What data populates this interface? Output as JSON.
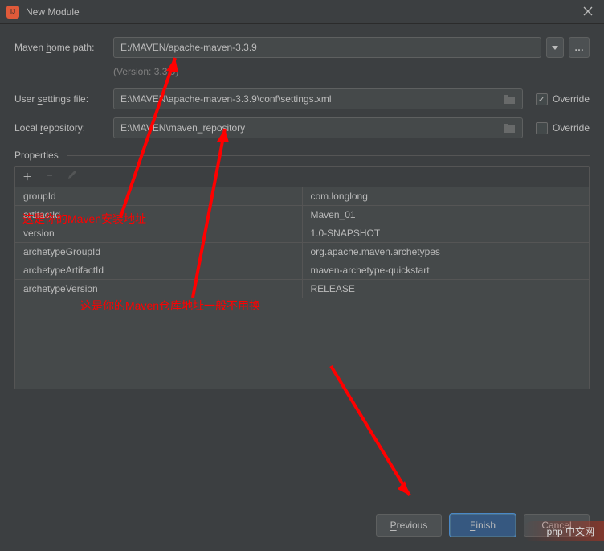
{
  "titlebar": {
    "title": "New Module"
  },
  "form": {
    "maven_home_label": "Maven home path:",
    "maven_home_value": "E:/MAVEN/apache-maven-3.3.9",
    "version_text": "(Version: 3.3.9)",
    "settings_label": "User settings file:",
    "settings_value": "E:\\MAVEN\\apache-maven-3.3.9\\conf\\settings.xml",
    "settings_override_checked": true,
    "repo_label": "Local repository:",
    "repo_value": "E:\\MAVEN\\maven_repository",
    "repo_override_checked": false,
    "override_label": "Override"
  },
  "properties": {
    "header": "Properties",
    "rows": [
      {
        "key": "groupId",
        "value": "com.longlong"
      },
      {
        "key": "artifactId",
        "value": "Maven_01"
      },
      {
        "key": "version",
        "value": "1.0-SNAPSHOT"
      },
      {
        "key": "archetypeGroupId",
        "value": "org.apache.maven.archetypes"
      },
      {
        "key": "archetypeArtifactId",
        "value": "maven-archetype-quickstart"
      },
      {
        "key": "archetypeVersion",
        "value": "RELEASE"
      }
    ]
  },
  "buttons": {
    "previous": "Previous",
    "finish": "Finish",
    "cancel": "Cancel"
  },
  "annotations": {
    "line1": "这是你的Maven安装地址",
    "line2": "这是你的Maven仓库地址一般不用换"
  },
  "watermark": "php 中文网"
}
